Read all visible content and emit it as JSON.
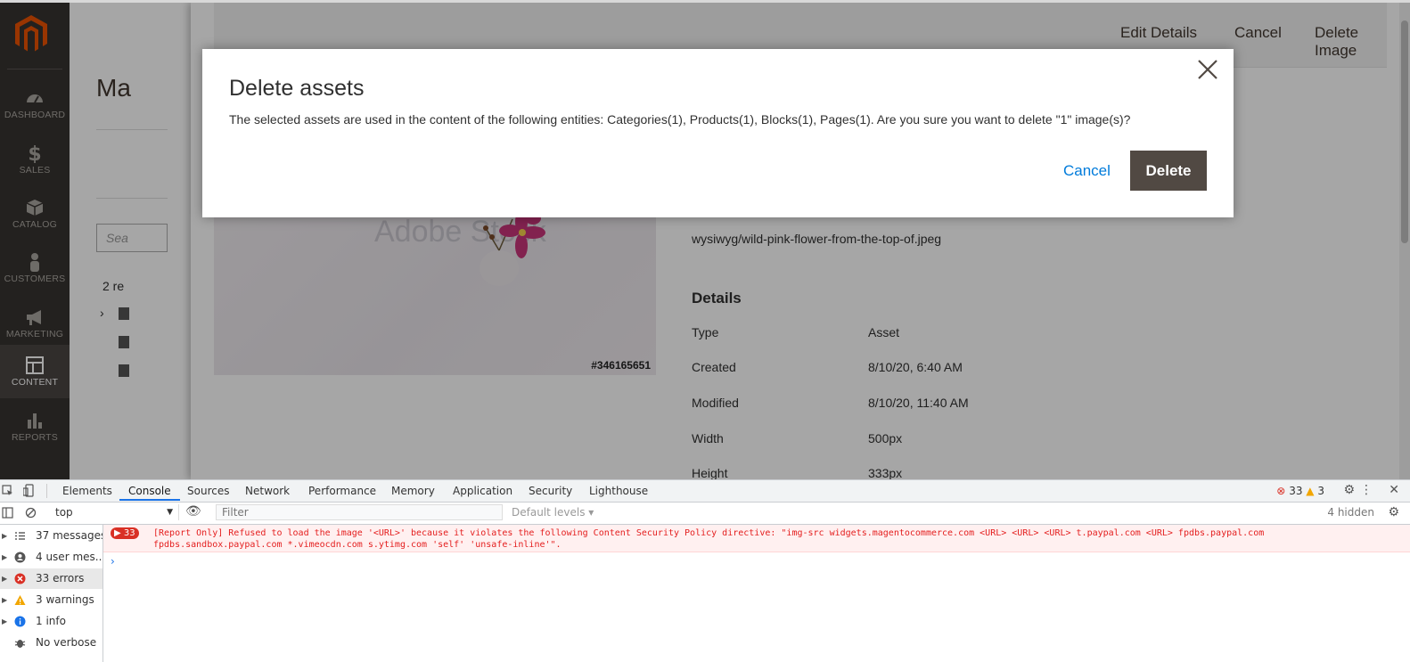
{
  "sidebar": {
    "items": [
      {
        "label": "DASHBOARD",
        "icon": "dashboard-icon"
      },
      {
        "label": "SALES",
        "icon": "dollar-icon"
      },
      {
        "label": "CATALOG",
        "icon": "cube-icon"
      },
      {
        "label": "CUSTOMERS",
        "icon": "person-icon"
      },
      {
        "label": "MARKETING",
        "icon": "megaphone-icon"
      },
      {
        "label": "CONTENT",
        "icon": "layout-icon",
        "active": true
      },
      {
        "label": "REPORTS",
        "icon": "bar-chart-icon"
      }
    ]
  },
  "background_page": {
    "title": "Ma",
    "search_placeholder": "Sea",
    "records": "2 re"
  },
  "panel": {
    "header_buttons": {
      "edit": "Edit Details",
      "cancel": "Cancel",
      "delete": "Delete Image"
    },
    "image_id": "#346165651",
    "watermark": "Adobe Stock",
    "path": "wysiwyg/wild-pink-flower-from-the-top-of.jpeg",
    "details_title": "Details",
    "details": [
      {
        "label": "Type",
        "value": "Asset"
      },
      {
        "label": "Created",
        "value": "8/10/20, 6:40 AM"
      },
      {
        "label": "Modified",
        "value": "8/10/20, 11:40 AM"
      },
      {
        "label": "Width",
        "value": "500px"
      },
      {
        "label": "Height",
        "value": "333px"
      }
    ]
  },
  "modal": {
    "title": "Delete assets",
    "message": "The selected assets are used in the content of the following entities: Categories(1), Products(1), Blocks(1), Pages(1). Are you sure you want to delete \"1\" image(s)?",
    "cancel": "Cancel",
    "delete": "Delete"
  },
  "devtools": {
    "tabs": [
      "Elements",
      "Console",
      "Sources",
      "Network",
      "Performance",
      "Memory",
      "Application",
      "Security",
      "Lighthouse"
    ],
    "active_tab": "Console",
    "error_count": "33",
    "warning_count": "3",
    "context": "top",
    "filter_placeholder": "Filter",
    "levels": "Default levels",
    "hidden": "4 hidden",
    "sidebar": [
      {
        "label": "37 messages",
        "icon": "list-icon"
      },
      {
        "label": "4 user mes...",
        "icon": "user-icon"
      },
      {
        "label": "33 errors",
        "icon": "error-icon"
      },
      {
        "label": "3 warnings",
        "icon": "warning-icon"
      },
      {
        "label": "1 info",
        "icon": "info-icon"
      },
      {
        "label": "No verbose",
        "icon": "bug-icon"
      }
    ],
    "error_badge": "33",
    "error_message": "[Report Only] Refused to load the image '<URL>' because it violates the following Content Security Policy directive: \"img-src widgets.magentocommerce.com <URL> <URL> <URL> t.paypal.com <URL> fpdbs.paypal.com fpdbs.sandbox.paypal.com *.vimeocdn.com s.ytimg.com 'self' 'unsafe-inline'\"."
  },
  "colors": {
    "sidebar_bg": "#373330",
    "brand_orange": "#eb5202",
    "primary_button": "#514943",
    "link_blue": "#007bdb",
    "error_red": "#e41e1e"
  }
}
